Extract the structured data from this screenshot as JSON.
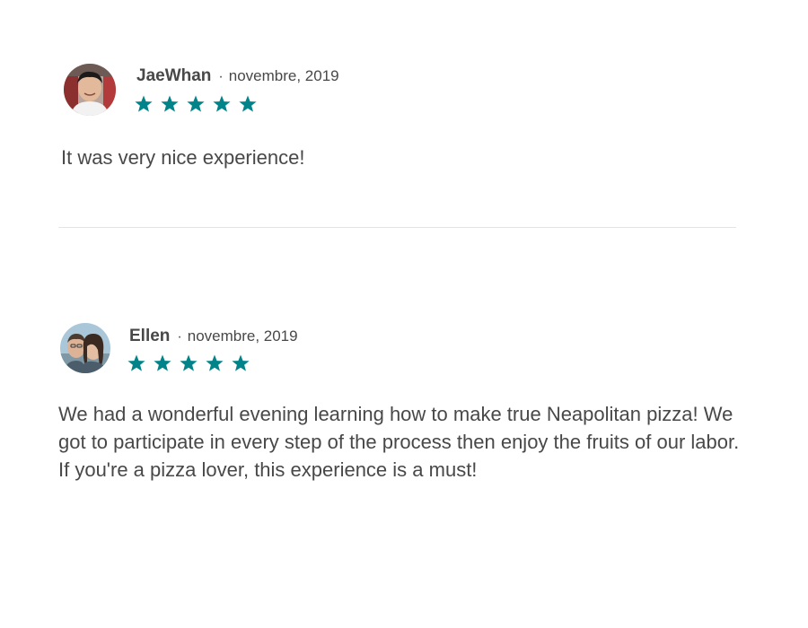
{
  "colors": {
    "star": "#008489",
    "text": "#484848",
    "divider": "#e4e4e4"
  },
  "reviews": [
    {
      "name": "JaeWhan",
      "separator": "·",
      "date": "novembre, 2019",
      "rating": 5,
      "avatar_icon": "user-photo-avatar",
      "text": "It was very nice experience!"
    },
    {
      "name": "Ellen",
      "separator": "·",
      "date": "novembre, 2019",
      "rating": 5,
      "avatar_icon": "couple-photo-avatar",
      "text": "We had a wonderful evening learning how to make true Neapolitan pizza! We got to participate in every step of the process then enjoy the fruits of our labor. If you're a pizza lover, this experience is a must!"
    }
  ]
}
